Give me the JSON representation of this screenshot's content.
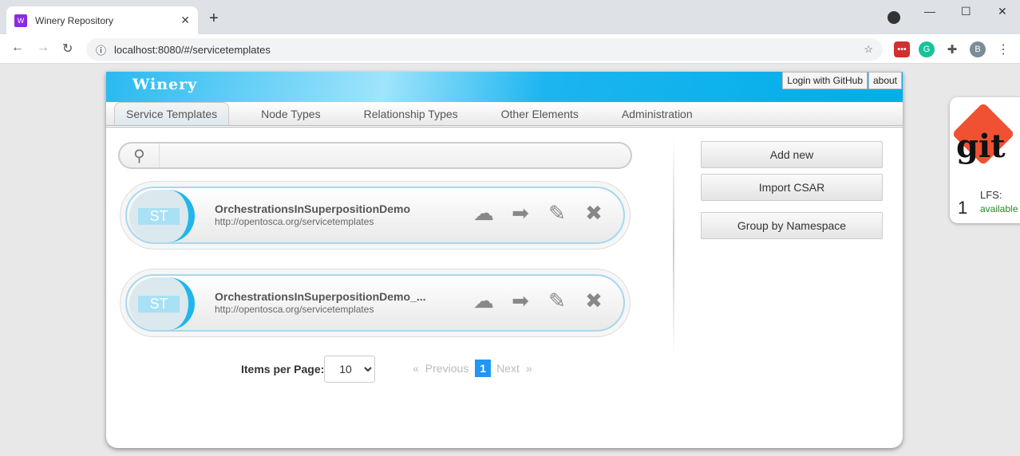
{
  "browser": {
    "tab_title": "Winery Repository",
    "favicon": "W",
    "url": "localhost:8080/#/servicetemplates",
    "profile": "B"
  },
  "header": {
    "logo": "Winery",
    "login_label": "Login with GitHub",
    "about_label": "about"
  },
  "menu": {
    "items": [
      {
        "label": "Service Templates",
        "active": true
      },
      {
        "label": "Node Types"
      },
      {
        "label": "Relationship Types"
      },
      {
        "label": "Other Elements"
      },
      {
        "label": "Administration"
      }
    ]
  },
  "search": {
    "placeholder": "",
    "value": ""
  },
  "items": [
    {
      "badge": "ST",
      "name": "OrchestrationsInSuperpositionDemo",
      "namespace": "http://opentosca.org/servicetemplates"
    },
    {
      "badge": "ST",
      "name": "OrchestrationsInSuperpositionDemo_...",
      "namespace": "http://opentosca.org/servicetemplates"
    }
  ],
  "actions": {
    "add_new": "Add new",
    "import_csar": "Import CSAR",
    "group_by_namespace": "Group by Namespace"
  },
  "pagination": {
    "items_per_page_label": "Items per Page:",
    "items_per_page": "10",
    "prev_arrow": "«",
    "previous": "Previous",
    "current_page": "1",
    "next": "Next",
    "next_arrow": "»"
  },
  "git": {
    "logo": "git",
    "count": "1",
    "lfs_label": "LFS:",
    "lfs_status": "available",
    "lfs_color": "#228b22"
  },
  "colors": {
    "accent": "#00aee8",
    "page_active": "#2196f3"
  }
}
